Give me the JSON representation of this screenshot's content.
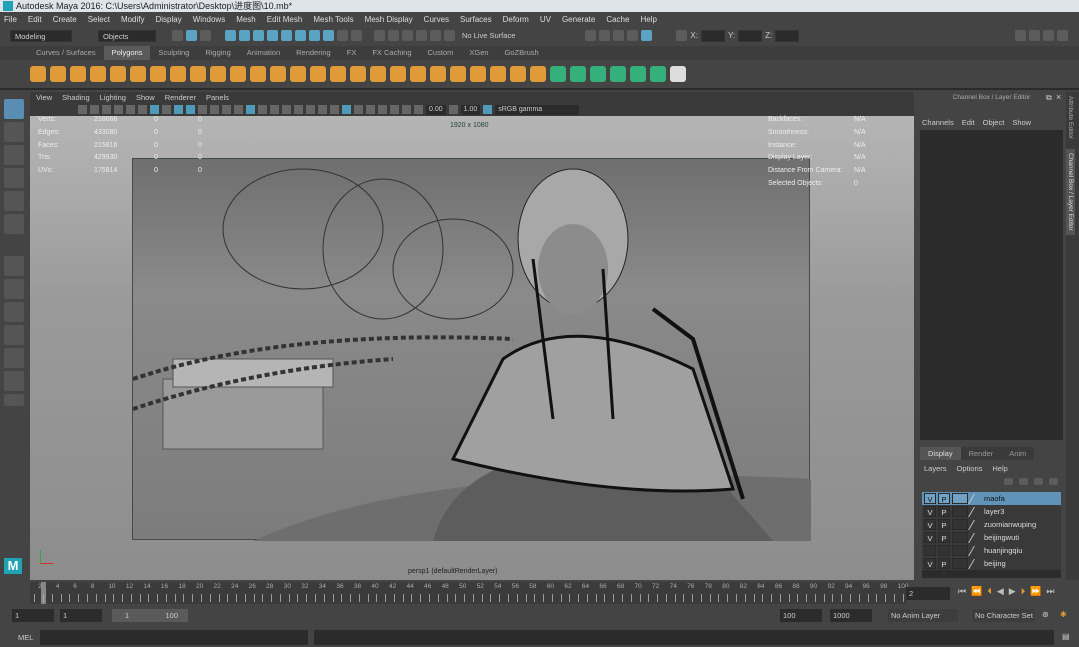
{
  "window": {
    "title": "Autodesk Maya 2016: C:\\Users\\Administrator\\Desktop\\进度图\\10.mb*"
  },
  "menubar": [
    "File",
    "Edit",
    "Create",
    "Select",
    "Modify",
    "Display",
    "Windows",
    "Mesh",
    "Edit Mesh",
    "Mesh Tools",
    "Mesh Display",
    "Curves",
    "Surfaces",
    "Deform",
    "UV",
    "Generate",
    "Cache",
    "Help"
  ],
  "status": {
    "menuset": "Modeling",
    "selection_mode": "Objects",
    "live_surface": "No Live Surface",
    "x_label": "X:",
    "y_label": "Y:",
    "z_label": "Z:"
  },
  "shelf_tabs": [
    {
      "label": "Curves / Surfaces"
    },
    {
      "label": "Polygons",
      "active": true
    },
    {
      "label": "Sculpting"
    },
    {
      "label": "Rigging"
    },
    {
      "label": "Animation"
    },
    {
      "label": "Rendering"
    },
    {
      "label": "FX"
    },
    {
      "label": "FX Caching"
    },
    {
      "label": "Custom"
    },
    {
      "label": "XGen"
    },
    {
      "label": "GoZBrush"
    }
  ],
  "viewport": {
    "menu": [
      "View",
      "Shading",
      "Lighting",
      "Show",
      "Renderer",
      "Panels"
    ],
    "exposure": "0.00",
    "gamma": "1.00",
    "color_space": "sRGB gamma",
    "resolution": "1920 x 1080",
    "camera_label": "persp1 (defaultRenderLayer)",
    "hud_left": [
      {
        "label": "Verts:",
        "v1": "218066",
        "v2": "0",
        "v3": "0"
      },
      {
        "label": "Edges:",
        "v1": "433080",
        "v2": "0",
        "v3": "0"
      },
      {
        "label": "Faces:",
        "v1": "215816",
        "v2": "0",
        "v3": "0"
      },
      {
        "label": "Tris:",
        "v1": "429930",
        "v2": "0",
        "v3": "0"
      },
      {
        "label": "UVs:",
        "v1": "175814",
        "v2": "0",
        "v3": "0"
      }
    ],
    "hud_right": [
      {
        "label": "Backfaces:",
        "value": "N/A"
      },
      {
        "label": "Smoothness:",
        "value": "N/A"
      },
      {
        "label": "Instance:",
        "value": "N/A"
      },
      {
        "label": "Display Layer:",
        "value": "N/A"
      },
      {
        "label": "Distance From Camera:",
        "value": "N/A"
      },
      {
        "label": "Selected Objects:",
        "value": "0"
      }
    ]
  },
  "channel_box": {
    "title": "Channel Box / Layer Editor",
    "menu": [
      "Channels",
      "Edit",
      "Object",
      "Show"
    ]
  },
  "layer_editor": {
    "tabs": [
      "Display",
      "Render",
      "Anim"
    ],
    "active_tab": "Display",
    "menu": [
      "Layers",
      "Options",
      "Help"
    ],
    "layers": [
      {
        "v": "V",
        "p": "P",
        "name": "maofa",
        "selected": true
      },
      {
        "v": "V",
        "p": "P",
        "name": "layer3"
      },
      {
        "v": "V",
        "p": "P",
        "name": "zuomianwuping"
      },
      {
        "v": "V",
        "p": "P",
        "name": "beijingwuti"
      },
      {
        "v": "",
        "p": "",
        "name": "huanjingqiu"
      },
      {
        "v": "V",
        "p": "P",
        "name": "beijing"
      }
    ]
  },
  "side_tabs": [
    "Attribute Editor",
    "Channel Box / Layer Editor"
  ],
  "timeline": {
    "start": 1,
    "end": 100,
    "label_step": 2,
    "current_frame": "2"
  },
  "range": {
    "start": "1",
    "playback_start": "1",
    "slider_start": "1",
    "slider_end": "100",
    "playback_end": "100",
    "end": "1000",
    "anim_layer": "No Anim Layer",
    "character_set": "No Character Set"
  },
  "command_line": {
    "language": "MEL"
  },
  "colors": {
    "accent": "#5a8db3",
    "shelf_icon": "#e09a38",
    "selected_layer": "#5f94b8"
  }
}
